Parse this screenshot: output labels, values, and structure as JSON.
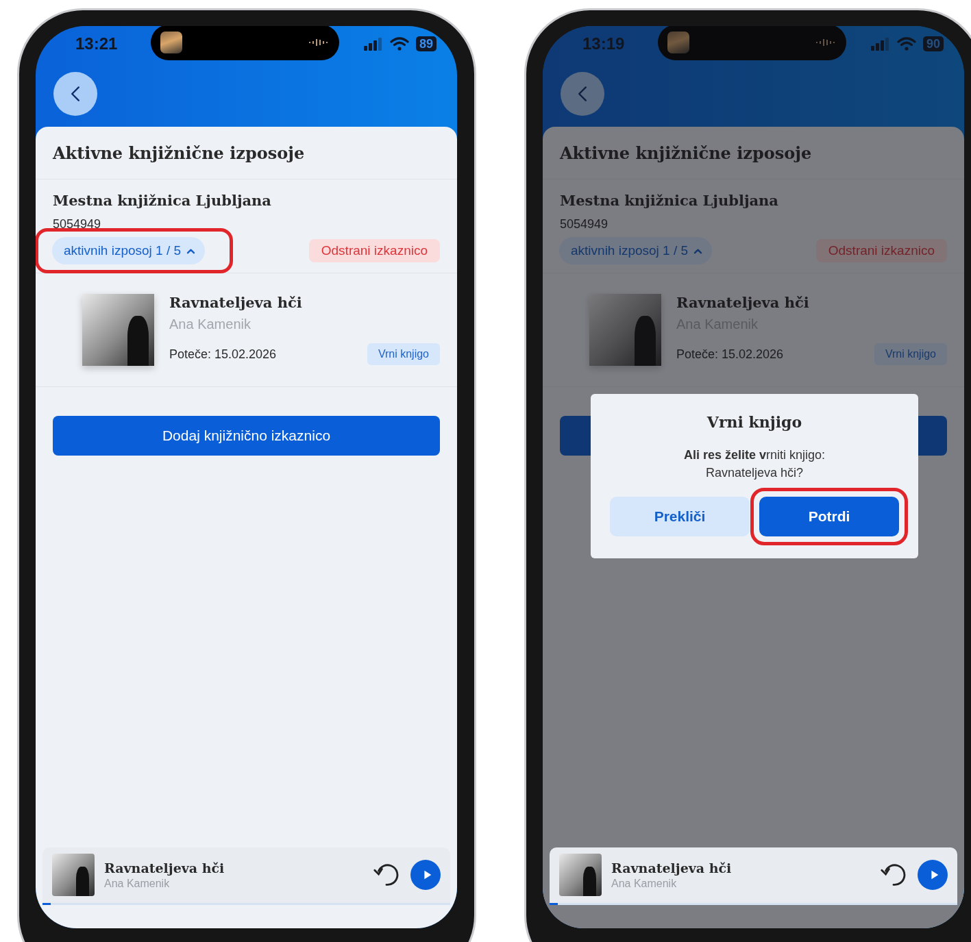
{
  "phones": [
    {
      "status_bar": {
        "time": "13:21",
        "battery": "89"
      },
      "dimmed": false,
      "title": "Aktivne knjižnične izposoje",
      "library": {
        "name": "Mestna knjižnica Ljubljana",
        "card_number": "5054949",
        "loans_chip": {
          "label": "aktivnih izposoj 1 / 5",
          "expanded": true,
          "highlighted": true
        },
        "remove_button": "Odstrani izkaznico"
      },
      "loans": [
        {
          "title": "Ravnateljeva hči",
          "author": "Ana Kamenik",
          "due": "Poteče: 15.02.2026",
          "return_button": "Vrni knjigo"
        }
      ],
      "add_button": "Dodaj knjižnično izkaznico",
      "player": {
        "title": "Ravnateljeva hči",
        "author": "Ana Kamenik",
        "level": 0.02
      }
    },
    {
      "status_bar": {
        "time": "13:19",
        "battery": "90"
      },
      "dimmed": true,
      "title": "Aktivne knjižnične izposoje",
      "library": {
        "name": "Mestna knjižnica Ljubljana",
        "card_number": "5054949",
        "loans_chip": {
          "label": "aktivnih izposoj 1 / 5",
          "expanded": true,
          "highlighted": false
        },
        "remove_button": "Odstrani izkaznico"
      },
      "loans": [
        {
          "title": "Ravnateljeva hči",
          "author": "Ana Kamenik",
          "due": "Poteče: 15.02.2026",
          "return_button": "Vrni knjigo"
        }
      ],
      "player": {
        "title": "Ravnateljeva hči",
        "author": "Ana Kamenik",
        "level": 0.02
      },
      "dialog": {
        "title": "Vrni knjigo",
        "message": [
          "**Ali res želite v**rniti knjigo:",
          "Ravnateljeva hči?"
        ],
        "buttons": [
          {
            "label": "Prekliči",
            "kind": "secondary",
            "highlighted": false
          },
          {
            "label": "Potrdi",
            "kind": "primary",
            "highlighted": true
          }
        ]
      }
    }
  ]
}
